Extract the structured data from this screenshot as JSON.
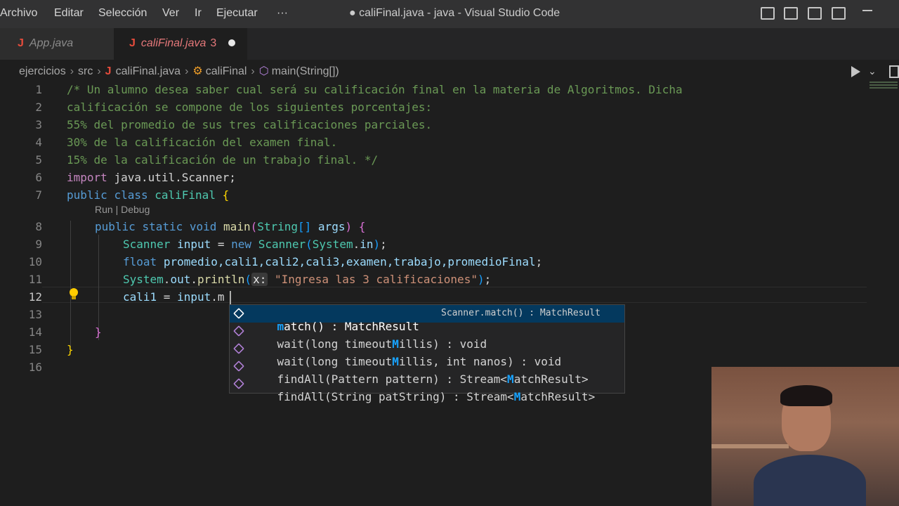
{
  "menu": {
    "items": [
      "Archivo",
      "Editar",
      "Selección",
      "Ver",
      "Ir",
      "Ejecutar",
      "···"
    ],
    "window_title": "● caliFinal.java - java - Visual Studio Code"
  },
  "tabs": {
    "app": {
      "label": "App.java"
    },
    "cali": {
      "label": "caliFinal.java",
      "problems": "3"
    }
  },
  "breadcrumb": {
    "folder1": "ejercicios",
    "folder2": "src",
    "file": "caliFinal.java",
    "class": "caliFinal",
    "method": "main(String[])"
  },
  "editor": {
    "line_numbers": [
      "1",
      "2",
      "3",
      "4",
      "5",
      "6",
      "7",
      "8",
      "9",
      "10",
      "11",
      "12",
      "13",
      "14",
      "15",
      "16"
    ],
    "codelens": "Run | Debug",
    "comment_lines": [
      "/* Un alumno desea saber cual será su calificación final en la materia de Algoritmos. Dicha",
      "calificación se compone de los siguientes porcentajes:",
      "55% del promedio de sus tres calificaciones parciales.",
      "30% de la calificación del examen final.",
      "15% de la calificación de un trabajo final. */"
    ],
    "import_kw": "import",
    "import_path": "java.util.Scanner;",
    "public_kw": "public",
    "class_kw": "class",
    "class_name": "caliFinal",
    "static_kw": "static",
    "void_kw": "void",
    "main_name": "main",
    "string_type": "String",
    "args_name": "args",
    "scanner_type": "Scanner",
    "input_var": "input",
    "new_kw": "new",
    "system_name": "System",
    "in_field": "in",
    "float_kw": "float",
    "float_vars": "promedio,cali1,cali2,cali3,examen,trabajo,promedioFinal",
    "out_field": "out",
    "println_name": "println",
    "param_hint": "x:",
    "string_literal": "\"Ingresa las 3 calificaciones\"",
    "cali1_var": "cali1",
    "typed": "m"
  },
  "suggestions": {
    "selected_detail": "Scanner.match() : MatchResult",
    "items": [
      {
        "pre": "",
        "hl": "m",
        "post": "atch() : MatchResult"
      },
      {
        "pre": "wait(long timeout",
        "hl": "M",
        "post": "illis) : void"
      },
      {
        "pre": "wait(long timeout",
        "hl": "M",
        "post": "illis, int nanos) : void"
      },
      {
        "pre": "findAll(Pattern pattern) : Stream<",
        "hl": "M",
        "post": "atchResult>"
      },
      {
        "pre": "findAll(String patString) : Stream<",
        "hl": "M",
        "post": "atchResult>"
      }
    ]
  },
  "colors": {
    "comment": "#6a9955",
    "keyword": "#569cd6",
    "type": "#4ec9b0",
    "function": "#dcdcaa",
    "string": "#ce9178",
    "selection": "#04395e",
    "error_tab": "#e5787a"
  },
  "icons": [
    "java-file-icon",
    "run-icon",
    "split-editor-icon",
    "lightbulb-icon",
    "method-icon",
    "class-icon"
  ]
}
